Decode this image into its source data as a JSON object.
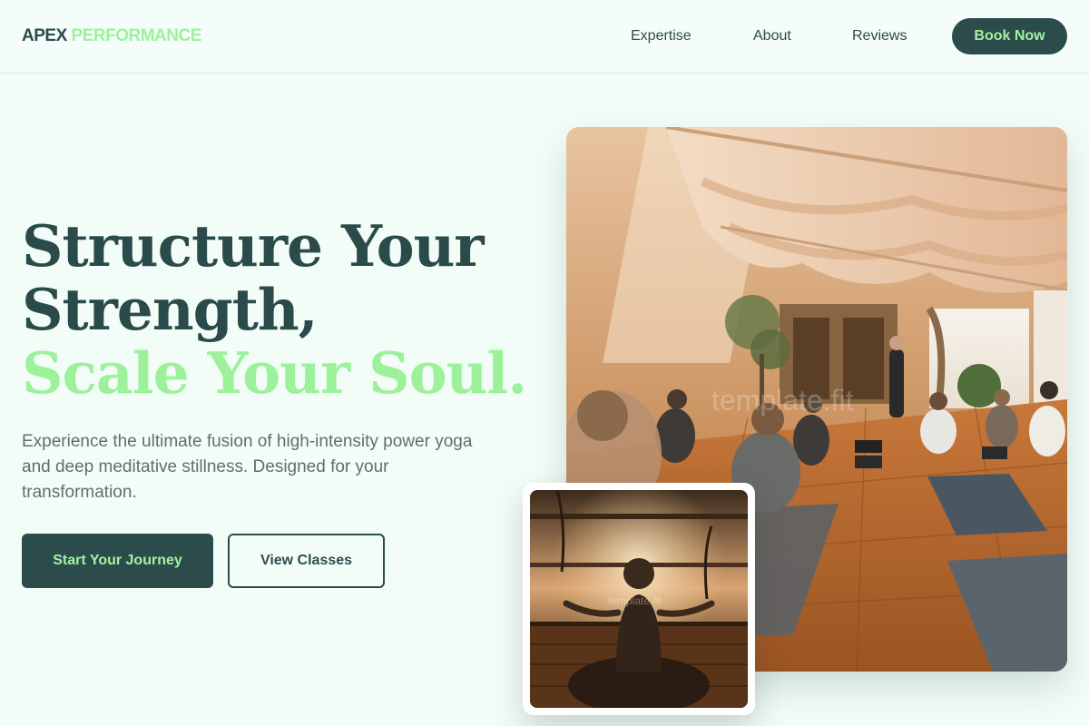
{
  "brand": {
    "part1": "APEX",
    "part2": "PERFORMANCE"
  },
  "nav": {
    "items": [
      {
        "label": "Expertise"
      },
      {
        "label": "About"
      },
      {
        "label": "Reviews"
      }
    ],
    "cta": "Book Now"
  },
  "hero": {
    "headline_line1": "Structure Your",
    "headline_line2": "Strength,",
    "headline_accent": "Scale Your Soul.",
    "description": "Experience the ultimate fusion of high-intensity power yoga and deep meditative stillness. Designed for your transformation.",
    "primary_cta": "Start Your Journey",
    "secondary_cta": "View Classes"
  },
  "images": {
    "main_watermark": "template.fit",
    "small_watermark": "template.fit"
  },
  "colors": {
    "background": "#f3fdf8",
    "primary_dark": "#2c4c4c",
    "accent_green": "#9ef09d",
    "body_text": "#5c7070"
  }
}
